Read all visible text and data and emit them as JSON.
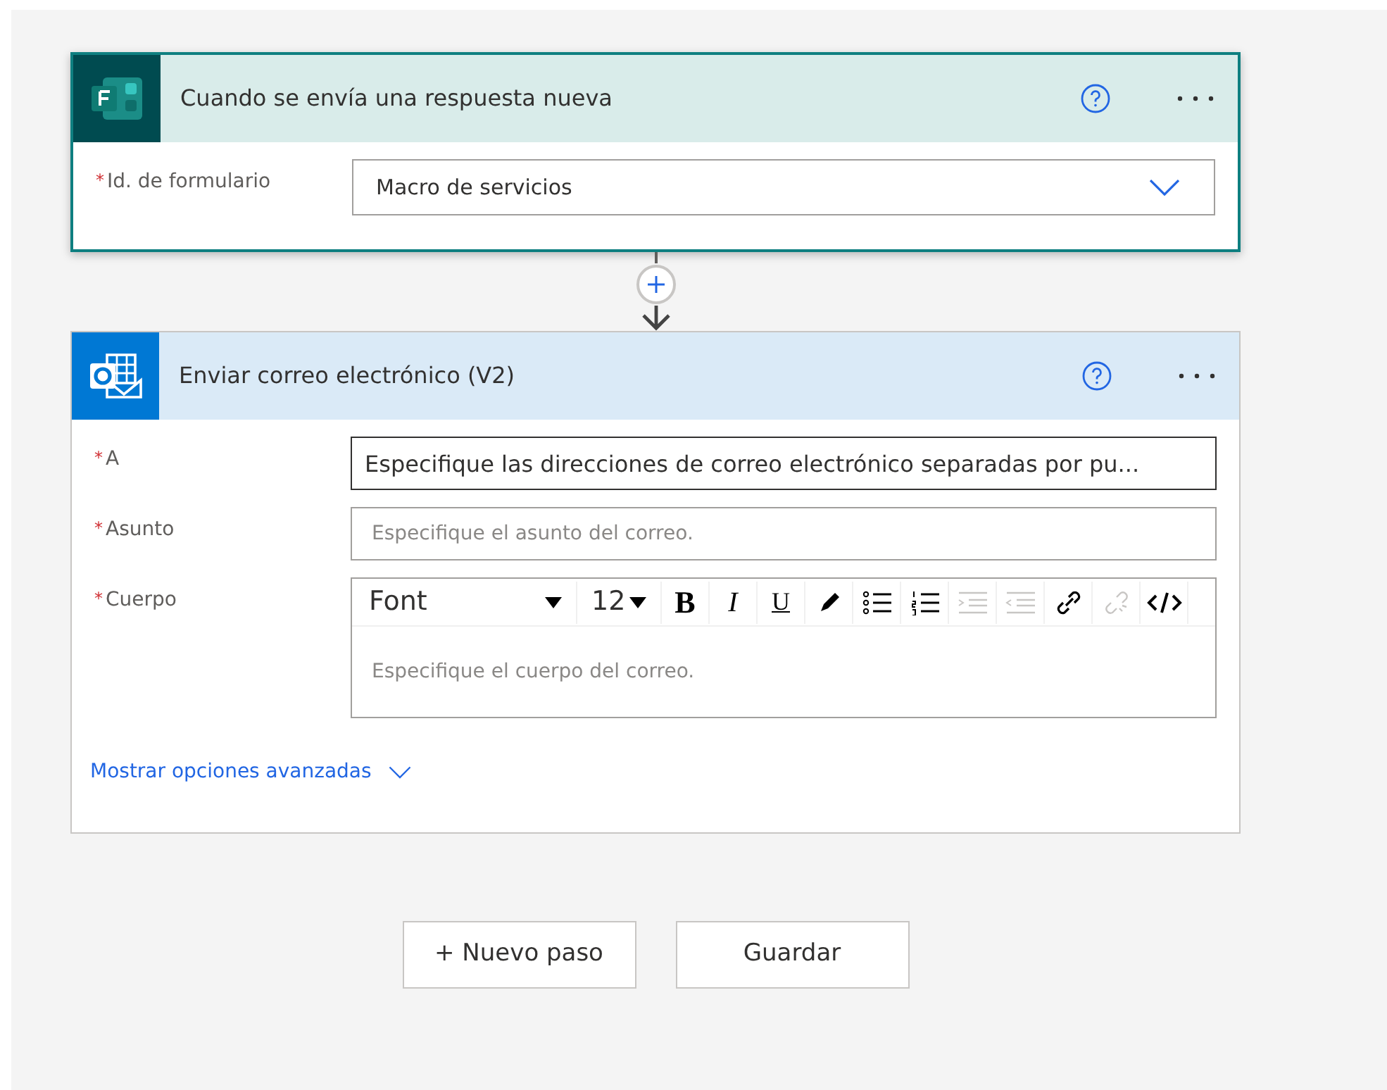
{
  "trigger": {
    "title": "Cuando se envía una respuesta nueva",
    "selected": true,
    "fields": [
      {
        "kind": "dropdown",
        "label": "Id. de formulario",
        "required_mark": "*",
        "value": "Macro de servicios"
      }
    ]
  },
  "action": {
    "title": "Enviar correo electrónico (V2)",
    "selected": false,
    "fields": [
      {
        "kind": "text",
        "label": "A",
        "required_mark": "*",
        "placeholder": "Especifique las direcciones de correo electrónico separadas por pu...",
        "focused": true
      },
      {
        "kind": "text",
        "label": "Asunto",
        "required_mark": "*",
        "placeholder": "Especifique el asunto del correo.",
        "focused": false
      },
      {
        "kind": "rich",
        "label": "Cuerpo",
        "required_mark": "*",
        "placeholder": "Especifique el cuerpo del correo.",
        "toolbar": [
          {
            "kind": "font",
            "label": "Font",
            "disabled": false
          },
          {
            "kind": "size",
            "label": "12",
            "disabled": false
          },
          {
            "kind": "bold",
            "label": "B",
            "disabled": false
          },
          {
            "kind": "italic",
            "label": "I",
            "disabled": false
          },
          {
            "kind": "underline",
            "label": "U",
            "disabled": false
          },
          {
            "kind": "color",
            "disabled": false
          },
          {
            "kind": "bullets",
            "disabled": false
          },
          {
            "kind": "numbers",
            "disabled": false
          },
          {
            "kind": "indent",
            "disabled": true
          },
          {
            "kind": "outdent",
            "disabled": true
          },
          {
            "kind": "link",
            "disabled": false
          },
          {
            "kind": "unlink",
            "disabled": true
          },
          {
            "kind": "code",
            "disabled": false
          }
        ]
      }
    ],
    "advanced": "Mostrar opciones avanzadas"
  },
  "buttons": [
    "+ Nuevo paso",
    "Guardar"
  ]
}
